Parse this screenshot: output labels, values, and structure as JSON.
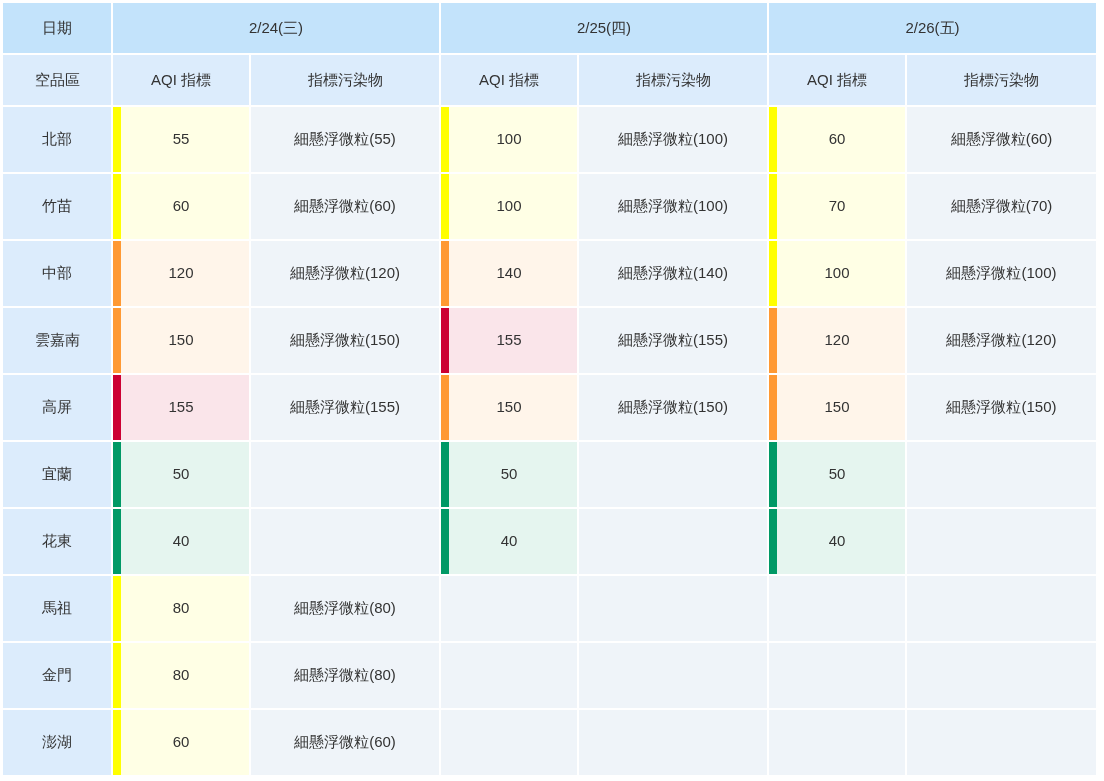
{
  "header": {
    "date_label": "日期",
    "region_label": "空品區",
    "days": [
      {
        "date": "2/24(三)",
        "aqi_label": "AQI 指標",
        "pollutant_label": "指標污染物"
      },
      {
        "date": "2/25(四)",
        "aqi_label": "AQI 指標",
        "pollutant_label": "指標污染物"
      },
      {
        "date": "2/26(五)",
        "aqi_label": "AQI 指標",
        "pollutant_label": "指標污染物"
      }
    ]
  },
  "rows": [
    {
      "region": "北部",
      "days": [
        {
          "aqi": "55",
          "color": "#ffff00",
          "pollutant": "細懸浮微粒(55)"
        },
        {
          "aqi": "100",
          "color": "#ffff00",
          "pollutant": "細懸浮微粒(100)"
        },
        {
          "aqi": "60",
          "color": "#ffff00",
          "pollutant": "細懸浮微粒(60)"
        }
      ]
    },
    {
      "region": "竹苗",
      "days": [
        {
          "aqi": "60",
          "color": "#ffff00",
          "pollutant": "細懸浮微粒(60)"
        },
        {
          "aqi": "100",
          "color": "#ffff00",
          "pollutant": "細懸浮微粒(100)"
        },
        {
          "aqi": "70",
          "color": "#ffff00",
          "pollutant": "細懸浮微粒(70)"
        }
      ]
    },
    {
      "region": "中部",
      "days": [
        {
          "aqi": "120",
          "color": "#ff9933",
          "pollutant": "細懸浮微粒(120)"
        },
        {
          "aqi": "140",
          "color": "#ff9933",
          "pollutant": "細懸浮微粒(140)"
        },
        {
          "aqi": "100",
          "color": "#ffff00",
          "pollutant": "細懸浮微粒(100)"
        }
      ]
    },
    {
      "region": "雲嘉南",
      "days": [
        {
          "aqi": "150",
          "color": "#ff9933",
          "pollutant": "細懸浮微粒(150)"
        },
        {
          "aqi": "155",
          "color": "#cc0033",
          "pollutant": "細懸浮微粒(155)"
        },
        {
          "aqi": "120",
          "color": "#ff9933",
          "pollutant": "細懸浮微粒(120)"
        }
      ]
    },
    {
      "region": "高屏",
      "days": [
        {
          "aqi": "155",
          "color": "#cc0033",
          "pollutant": "細懸浮微粒(155)"
        },
        {
          "aqi": "150",
          "color": "#ff9933",
          "pollutant": "細懸浮微粒(150)"
        },
        {
          "aqi": "150",
          "color": "#ff9933",
          "pollutant": "細懸浮微粒(150)"
        }
      ]
    },
    {
      "region": "宜蘭",
      "days": [
        {
          "aqi": "50",
          "color": "#009966"
        },
        {
          "aqi": "50",
          "color": "#009966"
        },
        {
          "aqi": "50",
          "color": "#009966"
        }
      ]
    },
    {
      "region": "花東",
      "days": [
        {
          "aqi": "40",
          "color": "#009966"
        },
        {
          "aqi": "40",
          "color": "#009966"
        },
        {
          "aqi": "40",
          "color": "#009966"
        }
      ]
    },
    {
      "region": "馬祖",
      "days": [
        {
          "aqi": "80",
          "color": "#ffff00",
          "pollutant": "細懸浮微粒(80)"
        }
      ]
    },
    {
      "region": "金門",
      "days": [
        {
          "aqi": "80",
          "color": "#ffff00",
          "pollutant": "細懸浮微粒(80)"
        }
      ]
    },
    {
      "region": "澎湖",
      "days": [
        {
          "aqi": "60",
          "color": "#ffff00",
          "pollutant": "細懸浮微粒(60)"
        }
      ]
    }
  ]
}
